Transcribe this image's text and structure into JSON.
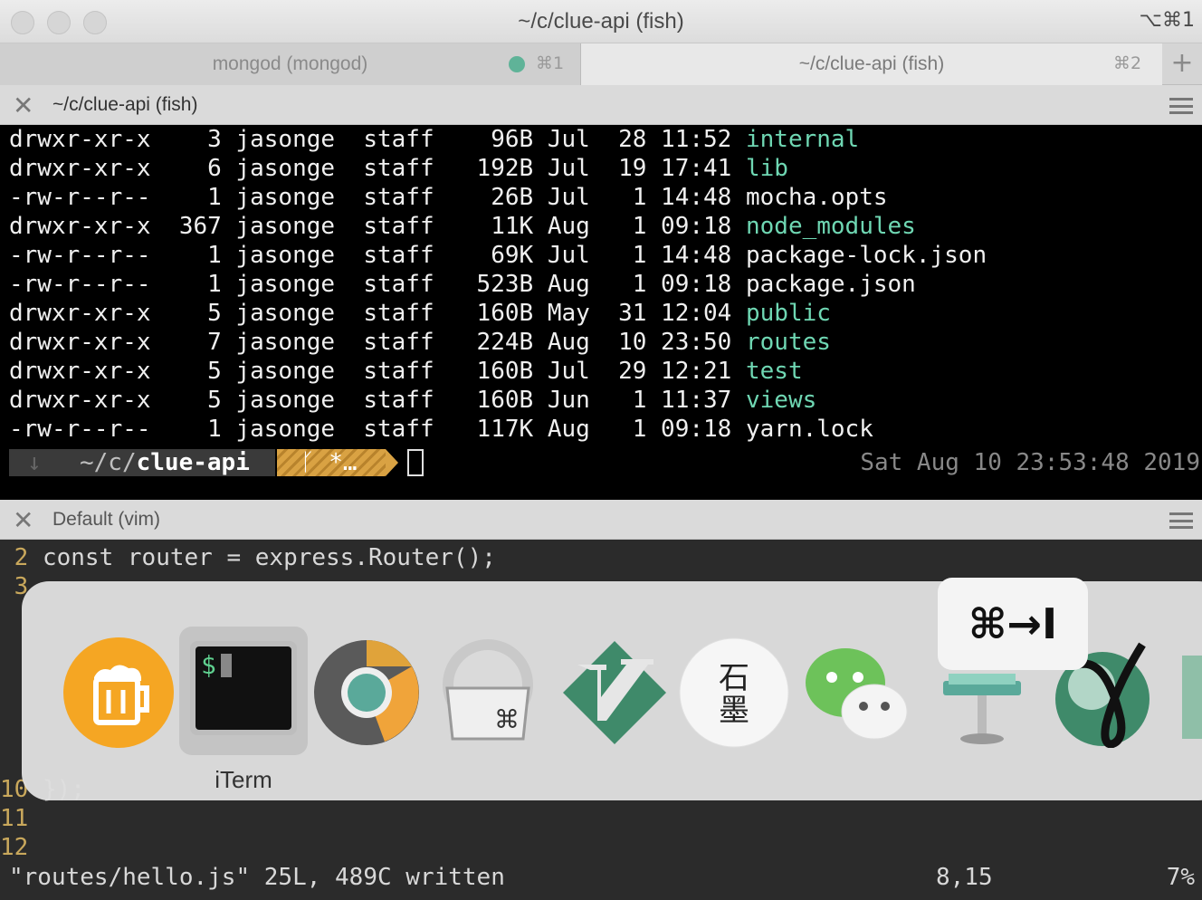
{
  "window": {
    "title": "~/c/clue-api (fish)",
    "shortcut": "⌥⌘1"
  },
  "tabs": [
    {
      "label": "mongod (mongod)",
      "shortcut": "⌘1",
      "active": false
    },
    {
      "label": "~/c/clue-api (fish)",
      "shortcut": "⌘2",
      "active": true
    }
  ],
  "tab_plus": "+",
  "pane_top": {
    "close": "✕",
    "title": "~/c/clue-api (fish)",
    "listing": [
      {
        "perms": "drwxr-xr-x",
        "links": "3",
        "owner": "jasonge",
        "group": "staff",
        "size": "96B",
        "month": "Jul",
        "day": "28",
        "time": "11:52",
        "name": "internal",
        "dir": true
      },
      {
        "perms": "drwxr-xr-x",
        "links": "6",
        "owner": "jasonge",
        "group": "staff",
        "size": "192B",
        "month": "Jul",
        "day": "19",
        "time": "17:41",
        "name": "lib",
        "dir": true
      },
      {
        "perms": "-rw-r--r--",
        "links": "1",
        "owner": "jasonge",
        "group": "staff",
        "size": "26B",
        "month": "Jul",
        "day": "1",
        "time": "14:48",
        "name": "mocha.opts",
        "dir": false
      },
      {
        "perms": "drwxr-xr-x",
        "links": "367",
        "owner": "jasonge",
        "group": "staff",
        "size": "11K",
        "month": "Aug",
        "day": "1",
        "time": "09:18",
        "name": "node_modules",
        "dir": true
      },
      {
        "perms": "-rw-r--r--",
        "links": "1",
        "owner": "jasonge",
        "group": "staff",
        "size": "69K",
        "month": "Jul",
        "day": "1",
        "time": "14:48",
        "name": "package-lock.json",
        "dir": false
      },
      {
        "perms": "-rw-r--r--",
        "links": "1",
        "owner": "jasonge",
        "group": "staff",
        "size": "523B",
        "month": "Aug",
        "day": "1",
        "time": "09:18",
        "name": "package.json",
        "dir": false
      },
      {
        "perms": "drwxr-xr-x",
        "links": "5",
        "owner": "jasonge",
        "group": "staff",
        "size": "160B",
        "month": "May",
        "day": "31",
        "time": "12:04",
        "name": "public",
        "dir": true
      },
      {
        "perms": "drwxr-xr-x",
        "links": "7",
        "owner": "jasonge",
        "group": "staff",
        "size": "224B",
        "month": "Aug",
        "day": "10",
        "time": "23:50",
        "name": "routes",
        "dir": true
      },
      {
        "perms": "drwxr-xr-x",
        "links": "5",
        "owner": "jasonge",
        "group": "staff",
        "size": "160B",
        "month": "Jul",
        "day": "29",
        "time": "12:21",
        "name": "test",
        "dir": true
      },
      {
        "perms": "drwxr-xr-x",
        "links": "5",
        "owner": "jasonge",
        "group": "staff",
        "size": "160B",
        "month": "Jun",
        "day": "1",
        "time": "11:37",
        "name": "views",
        "dir": true
      },
      {
        "perms": "-rw-r--r--",
        "links": "1",
        "owner": "jasonge",
        "group": "staff",
        "size": "117K",
        "month": "Aug",
        "day": "1",
        "time": "09:18",
        "name": "yarn.lock",
        "dir": false
      }
    ],
    "prompt": {
      "path_prefix": "~/c/",
      "path_dir": "clue-api",
      "git": "ᚴ *…",
      "clock": "Sat Aug 10 23:53:48 2019"
    }
  },
  "pane_bottom": {
    "close": "✕",
    "title": "Default (vim)",
    "lines": [
      {
        "num": " 2",
        "text": " const router = express.Router();"
      },
      {
        "num": " 3",
        "text": ""
      },
      {
        "num": "10",
        "text": " });"
      },
      {
        "num": "11",
        "text": ""
      },
      {
        "num": "12",
        "text": ""
      }
    ],
    "status": {
      "message": "\"routes/hello.js\" 25L, 489C written",
      "position": "8,15",
      "percent": "7%"
    }
  },
  "app_switcher": {
    "selected_label": "iTerm",
    "hint": "⌘→I",
    "apps": [
      "beer-mug-icon",
      "iterm-icon",
      "chrome-icon",
      "keyboard-icon",
      "vim-icon",
      "inkstone-icon",
      "wechat-icon",
      "keynote-icon",
      "gamma-icon",
      "stamp-icon"
    ],
    "iterm_prompt": "$",
    "inkstone_text": "石墨",
    "colors": {
      "accent_green": "#6fd7b3",
      "beer_orange": "#f5a623"
    }
  }
}
